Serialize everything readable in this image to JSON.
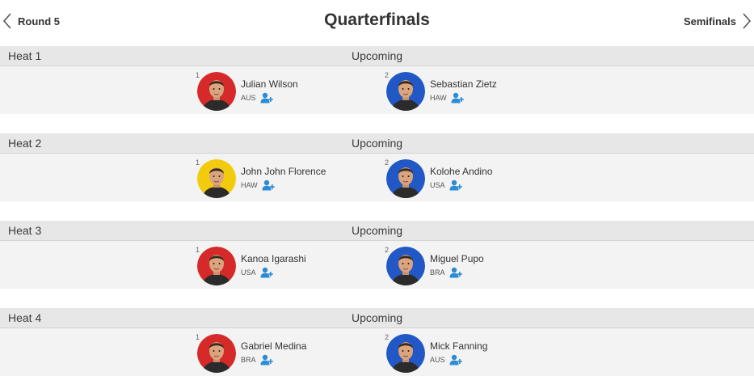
{
  "header": {
    "prev_label": "Round 5",
    "title": "Quarterfinals",
    "next_label": "Semifinals"
  },
  "colors": {
    "red": "#d62a2a",
    "yellow": "#f2cc0c",
    "blue": "#2258c5",
    "follow": "#2a8bd6"
  },
  "heats": [
    {
      "label": "Heat 1",
      "status": "Upcoming",
      "surfers": [
        {
          "seed": "1",
          "name": "Julian Wilson",
          "country": "AUS",
          "jersey": "red"
        },
        {
          "seed": "2",
          "name": "Sebastian Zietz",
          "country": "HAW",
          "jersey": "blue"
        }
      ]
    },
    {
      "label": "Heat 2",
      "status": "Upcoming",
      "surfers": [
        {
          "seed": "1",
          "name": "John John Florence",
          "country": "HAW",
          "jersey": "yellow"
        },
        {
          "seed": "2",
          "name": "Kolohe Andino",
          "country": "USA",
          "jersey": "blue"
        }
      ]
    },
    {
      "label": "Heat 3",
      "status": "Upcoming",
      "surfers": [
        {
          "seed": "1",
          "name": "Kanoa Igarashi",
          "country": "USA",
          "jersey": "red"
        },
        {
          "seed": "2",
          "name": "Miguel Pupo",
          "country": "BRA",
          "jersey": "blue"
        }
      ]
    },
    {
      "label": "Heat 4",
      "status": "Upcoming",
      "surfers": [
        {
          "seed": "1",
          "name": "Gabriel Medina",
          "country": "BRA",
          "jersey": "red"
        },
        {
          "seed": "2",
          "name": "Mick Fanning",
          "country": "AUS",
          "jersey": "blue"
        }
      ]
    }
  ]
}
